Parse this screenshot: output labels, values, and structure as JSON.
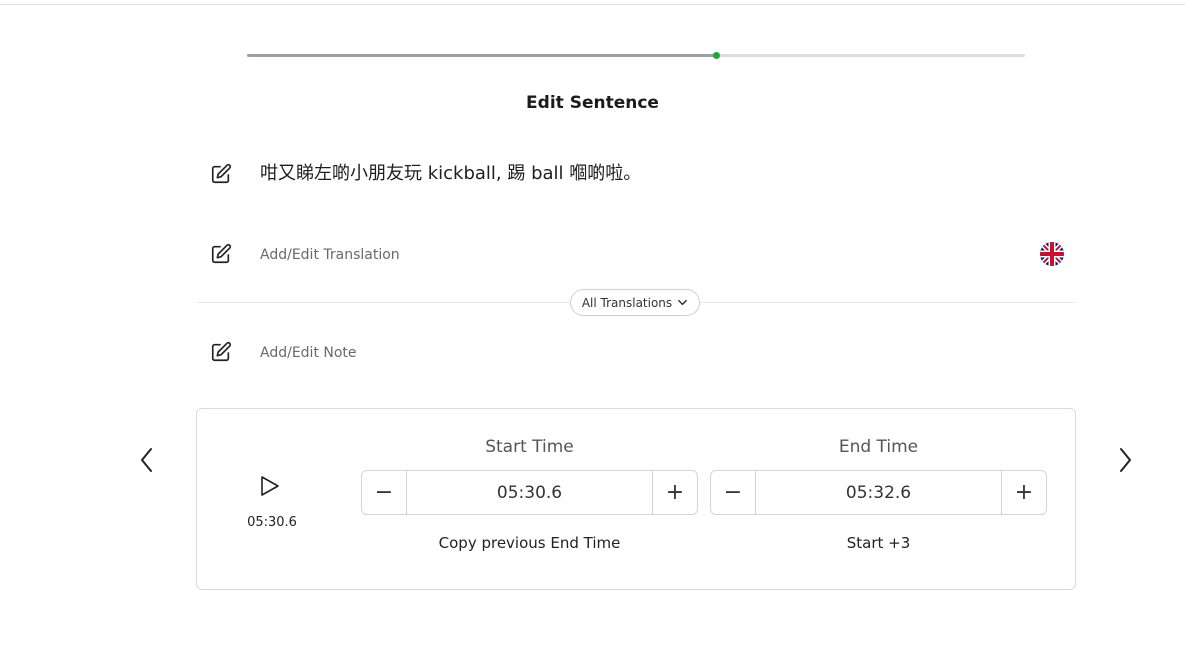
{
  "progress": {
    "fraction": 0.603
  },
  "page_title": "Edit Sentence",
  "sentence": {
    "text": "咁又睇左啲小朋友玩 kickball, 踢 ball 嗰啲啦。",
    "edit_icon": "edit-icon"
  },
  "translation": {
    "label": "Add/Edit Translation",
    "edit_icon": "edit-icon",
    "language_icon": "uk-flag-icon"
  },
  "all_translations": {
    "label": "All Translations",
    "icon": "chevron-down-icon"
  },
  "note": {
    "label": "Add/Edit Note",
    "edit_icon": "edit-icon"
  },
  "navigation": {
    "prev_icon": "chevron-left-icon",
    "next_icon": "chevron-right-icon"
  },
  "playback": {
    "play_icon": "play-icon",
    "current_time": "05:30.6"
  },
  "start_time": {
    "label": "Start Time",
    "value": "05:30.6",
    "minus": "−",
    "plus": "+",
    "action": "Copy previous End Time"
  },
  "end_time": {
    "label": "End Time",
    "value": "05:32.6",
    "minus": "−",
    "plus": "+",
    "action": "Start +3"
  },
  "colors": {
    "progress_fill": "#9aa1a6",
    "progress_dot": "#1fa83a",
    "border": "#dadada"
  }
}
